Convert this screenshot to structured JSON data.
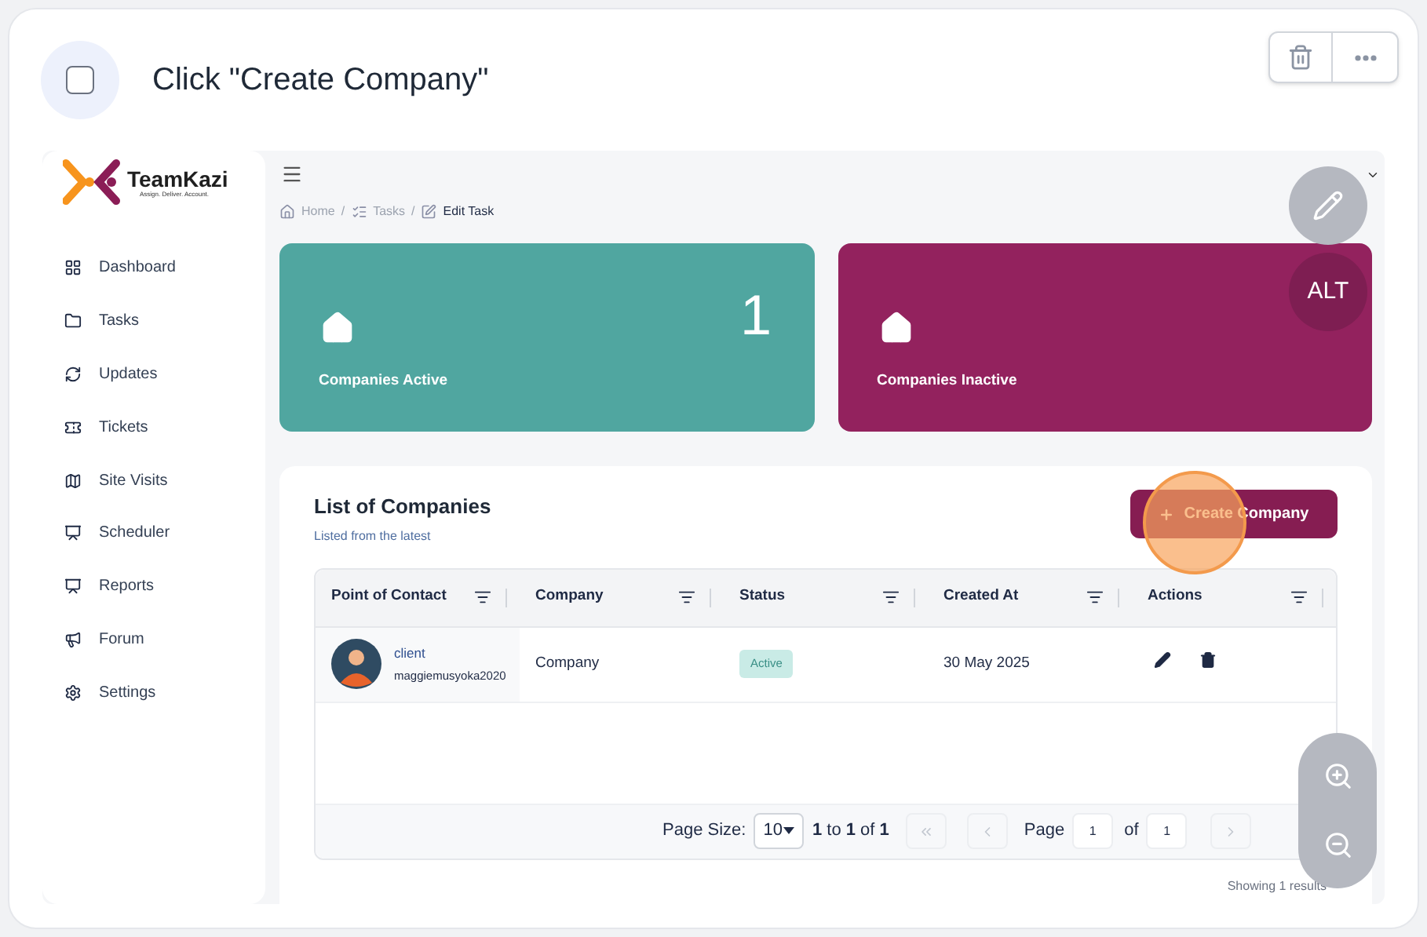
{
  "step": {
    "checked": false,
    "title": "Click \"Create Company\""
  },
  "brand": {
    "name": "TeamKazi",
    "tagline": "Assign. Deliver. Account."
  },
  "nav": [
    {
      "label": "Dashboard"
    },
    {
      "label": "Tasks"
    },
    {
      "label": "Updates"
    },
    {
      "label": "Tickets"
    },
    {
      "label": "Site Visits"
    },
    {
      "label": "Scheduler"
    },
    {
      "label": "Reports"
    },
    {
      "label": "Forum"
    },
    {
      "label": "Settings"
    }
  ],
  "breadcrumb": [
    {
      "label": "Home",
      "current": false
    },
    {
      "separator": "/"
    },
    {
      "label": "Tasks",
      "current": false
    },
    {
      "separator": "/"
    },
    {
      "label": "Edit Task",
      "current": true
    }
  ],
  "stats": [
    {
      "label": "Companies Active",
      "value": "1",
      "color": "#50a6a0"
    },
    {
      "label": "Companies Inactive",
      "color": "#93225e"
    }
  ],
  "list": {
    "title": "List of Companies",
    "subtitle": "Listed from the latest",
    "create_button": "Create Company",
    "columns": [
      "Point of Contact",
      "Company",
      "Status",
      "Created At",
      "Actions"
    ],
    "rows": [
      {
        "contact_name": "client",
        "contact_email": "maggiemusyoka2020",
        "company": "Company",
        "status": "Active",
        "created_at": "30 May 2025"
      }
    ],
    "pagination": {
      "page_size_label": "Page Size:",
      "page_size": "10",
      "range": "**1** to **1** of **1**",
      "page_label": "Page",
      "page": "1",
      "of_label": "of",
      "total_pages": "1"
    },
    "results": "Showing 1 results"
  },
  "overlay": {
    "alt_label": "ALT"
  }
}
